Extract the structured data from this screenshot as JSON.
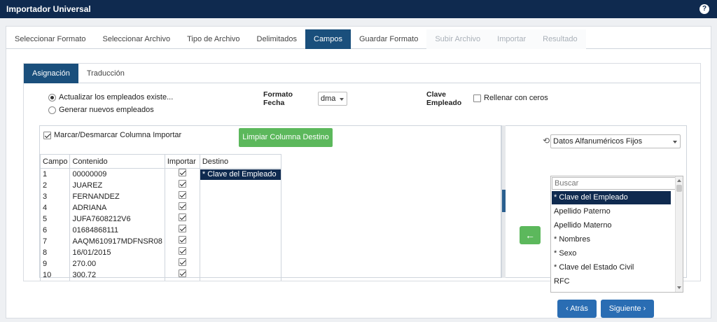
{
  "app": {
    "title": "Importador Universal",
    "help_icon": "?"
  },
  "steps": [
    {
      "label": "Seleccionar Formato",
      "state": "normal"
    },
    {
      "label": "Seleccionar Archivo",
      "state": "normal"
    },
    {
      "label": "Tipo de Archivo",
      "state": "normal"
    },
    {
      "label": "Delimitados",
      "state": "normal"
    },
    {
      "label": "Campos",
      "state": "active"
    },
    {
      "label": "Guardar Formato",
      "state": "normal"
    },
    {
      "label": "Subir Archivo",
      "state": "disabled"
    },
    {
      "label": "Importar",
      "state": "disabled"
    },
    {
      "label": "Resultado",
      "state": "disabled"
    }
  ],
  "subtabs": [
    {
      "label": "Asignación",
      "state": "active"
    },
    {
      "label": "Traducción",
      "state": "normal"
    }
  ],
  "options": {
    "radio_update": "Actualizar los empleados existe...",
    "radio_new": "Generar nuevos empleados",
    "formato_fecha_label": "Formato Fecha",
    "formato_fecha_value": "dma",
    "clave_empleado_label": "Clave Empleado",
    "rellenar_label": "Rellenar con ceros"
  },
  "grid": {
    "toggle_label": "Marcar/Desmarcar Columna Importar",
    "clear_button": "Limpiar Columna Destino",
    "headers": {
      "campo": "Campo",
      "contenido": "Contenido",
      "importar": "Importar",
      "destino": "Destino"
    },
    "rows": [
      {
        "campo": "1",
        "contenido": "00000009",
        "destino": "* Clave del Empleado"
      },
      {
        "campo": "2",
        "contenido": "JUAREZ",
        "destino": ""
      },
      {
        "campo": "3",
        "contenido": "FERNANDEZ",
        "destino": ""
      },
      {
        "campo": "4",
        "contenido": "ADRIANA",
        "destino": ""
      },
      {
        "campo": "5",
        "contenido": "JUFA7608212V6",
        "destino": ""
      },
      {
        "campo": "6",
        "contenido": "01684868111",
        "destino": ""
      },
      {
        "campo": "7",
        "contenido": "AAQM610917MDFNSR08",
        "destino": ""
      },
      {
        "campo": "8",
        "contenido": "16/01/2015",
        "destino": ""
      },
      {
        "campo": "9",
        "contenido": "270.00",
        "destino": ""
      },
      {
        "campo": "10",
        "contenido": "300.72",
        "destino": ""
      }
    ]
  },
  "target": {
    "dropdown_value": "Datos Alfanuméricos Fijos",
    "search_placeholder": "Buscar",
    "items": [
      "* Clave del Empleado",
      "Apellido Paterno",
      "Apellido Materno",
      "* Nombres",
      "* Sexo",
      "* Clave del Estado Civil",
      "RFC"
    ]
  },
  "nav": {
    "back": "Atrás",
    "next": "Siguiente"
  },
  "colors": {
    "navy": "#0f2a4f",
    "accent": "#1a4f7c",
    "green": "#5cb85c",
    "button_blue": "#2a6db3"
  }
}
